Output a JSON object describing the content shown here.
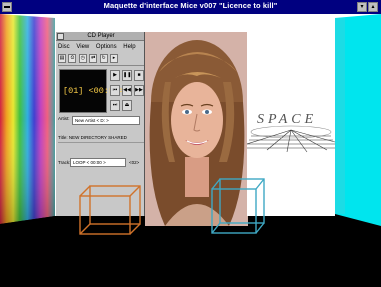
{
  "window": {
    "title": "Maquette d'interface Mice v007 \"Licence to kill\""
  },
  "colors": {
    "titlebar": "#000080",
    "cyan_wall": "#00e5ee",
    "floor": "#000000",
    "cube_orange": "#d0722a",
    "cube_cyan": "#3fa9c4"
  },
  "cd_player": {
    "title": "CD Player",
    "menu": [
      "Disc",
      "View",
      "Options",
      "Help"
    ],
    "display": "[01] <00:56>",
    "artist_label": "Artist:",
    "artist_value": "New Artist < D: >",
    "title_label": "Title: NEW DIRECTORY SHARED",
    "track_label": "Track:",
    "track_value": "LOOP < 00:00 >",
    "track_count": "<02>"
  },
  "space_image": {
    "text": "SPACE"
  }
}
